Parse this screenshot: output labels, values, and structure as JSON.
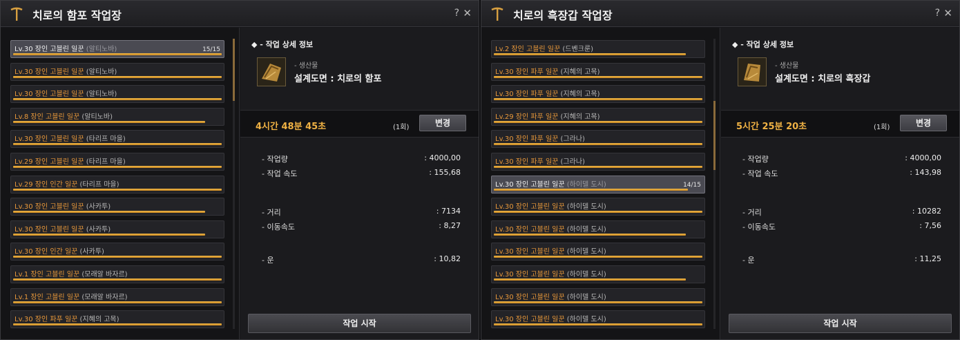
{
  "colors": {
    "accent": "#e8983a",
    "time": "#f0b244",
    "bar": "#e0a63a"
  },
  "left": {
    "title": "치로의 함포 작업장",
    "help": "?",
    "close": "✕",
    "section_title": "◆ - 작업 상세 정보",
    "product_label": "- 생산물",
    "product_name": "설계도면 : 치로의 함포",
    "time": "4시간 48분 45초",
    "count": "(1회)",
    "change_label": "변경",
    "stats": [
      {
        "label": "- 작업량",
        "value": ": 4000,00"
      },
      {
        "label": "- 작업 속도",
        "value": ": 155,68"
      },
      {
        "label": "- 거리",
        "value": ": 7134"
      },
      {
        "label": "- 이동속도",
        "value": ": 8,27"
      },
      {
        "label": "- 운",
        "value": ": 10,82"
      }
    ],
    "start_label": "작업 시작",
    "workers": [
      {
        "name": "Lv.30 장인 고블린 일꾼 ",
        "loc": "(알티노바)",
        "count": "15/15",
        "stamina": 1.0,
        "selected": true
      },
      {
        "name": "Lv.30 장인 고블린 일꾼 ",
        "loc": "(알티노바)",
        "count": "",
        "stamina": 1.0,
        "selected": false
      },
      {
        "name": "Lv.30 장인 고블린 일꾼 ",
        "loc": "(알티노바)",
        "count": "",
        "stamina": 1.0,
        "selected": false
      },
      {
        "name": "Lv.8 장인 고블린 일꾼 ",
        "loc": "(알티노바)",
        "count": "",
        "stamina": 0.92,
        "selected": false
      },
      {
        "name": "Lv.30 장인 고블린 일꾼 ",
        "loc": "(타리프 마을)",
        "count": "",
        "stamina": 1.0,
        "selected": false
      },
      {
        "name": "Lv.29 장인 고블린 일꾼 ",
        "loc": "(타리프 마을)",
        "count": "",
        "stamina": 1.0,
        "selected": false
      },
      {
        "name": "Lv.29 장인 인간 일꾼 ",
        "loc": "(타리프 마을)",
        "count": "",
        "stamina": 1.0,
        "selected": false
      },
      {
        "name": "Lv.30 장인 고블린 일꾼 ",
        "loc": "(사카투)",
        "count": "",
        "stamina": 0.92,
        "selected": false
      },
      {
        "name": "Lv.30 장인 고블린 일꾼 ",
        "loc": "(사카투)",
        "count": "",
        "stamina": 0.92,
        "selected": false
      },
      {
        "name": "Lv.30 장인 인간 일꾼 ",
        "loc": "(사카투)",
        "count": "",
        "stamina": 1.0,
        "selected": false
      },
      {
        "name": "Lv.1 장인 고블린 일꾼 ",
        "loc": "(모래알 바자르)",
        "count": "",
        "stamina": 1.0,
        "selected": false
      },
      {
        "name": "Lv.1 장인 고블린 일꾼 ",
        "loc": "(모래알 바자르)",
        "count": "",
        "stamina": 1.0,
        "selected": false
      },
      {
        "name": "Lv.30 장인 파푸 일꾼 ",
        "loc": "(지혜의 고목)",
        "count": "",
        "stamina": 1.0,
        "selected": false
      }
    ]
  },
  "right": {
    "title": "치로의 흑장갑 작업장",
    "help": "?",
    "close": "✕",
    "section_title": "◆ - 작업 상세 정보",
    "product_label": "- 생산물",
    "product_name": "설계도면 : 치로의 흑장갑",
    "time": "5시간 25분 20초",
    "count": "(1회)",
    "change_label": "변경",
    "stats": [
      {
        "label": "- 작업량",
        "value": ": 4000,00"
      },
      {
        "label": "- 작업 속도",
        "value": ": 143,98"
      },
      {
        "label": "- 거리",
        "value": ": 10282"
      },
      {
        "label": "- 이동속도",
        "value": ": 7,56"
      },
      {
        "label": "- 운",
        "value": ": 11,25"
      }
    ],
    "start_label": "작업 시작",
    "workers": [
      {
        "name": "Lv.2 장인 고블린 일꾼 ",
        "loc": "(드벤크룬)",
        "count": "",
        "stamina": 0.92,
        "selected": false
      },
      {
        "name": "Lv.30 장인 파푸 일꾼 ",
        "loc": "(지혜의 고목)",
        "count": "",
        "stamina": 1.0,
        "selected": false
      },
      {
        "name": "Lv.30 장인 파푸 일꾼 ",
        "loc": "(지혜의 고목)",
        "count": "",
        "stamina": 1.0,
        "selected": false
      },
      {
        "name": "Lv.29 장인 파푸 일꾼 ",
        "loc": "(지혜의 고목)",
        "count": "",
        "stamina": 1.0,
        "selected": false
      },
      {
        "name": "Lv.30 장인 파푸 일꾼 ",
        "loc": "(그라나)",
        "count": "",
        "stamina": 1.0,
        "selected": false
      },
      {
        "name": "Lv.30 장인 파푸 일꾼 ",
        "loc": "(그라나)",
        "count": "",
        "stamina": 1.0,
        "selected": false
      },
      {
        "name": "Lv.30 장인 고블린 일꾼 ",
        "loc": "(하이델 도시)",
        "count": "14/15",
        "stamina": 0.93,
        "selected": true
      },
      {
        "name": "Lv.30 장인 고블린 일꾼 ",
        "loc": "(하이델 도시)",
        "count": "",
        "stamina": 1.0,
        "selected": false
      },
      {
        "name": "Lv.30 장인 고블린 일꾼 ",
        "loc": "(하이델 도시)",
        "count": "",
        "stamina": 0.92,
        "selected": false
      },
      {
        "name": "Lv.30 장인 고블린 일꾼 ",
        "loc": "(하이델 도시)",
        "count": "",
        "stamina": 1.0,
        "selected": false
      },
      {
        "name": "Lv.30 장인 고블린 일꾼 ",
        "loc": "(하이델 도시)",
        "count": "",
        "stamina": 0.92,
        "selected": false
      },
      {
        "name": "Lv.30 장인 고블린 일꾼 ",
        "loc": "(하이델 도시)",
        "count": "",
        "stamina": 1.0,
        "selected": false
      },
      {
        "name": "Lv.30 장인 고블린 일꾼 ",
        "loc": "(하이델 도시)",
        "count": "",
        "stamina": 1.0,
        "selected": false
      }
    ]
  }
}
